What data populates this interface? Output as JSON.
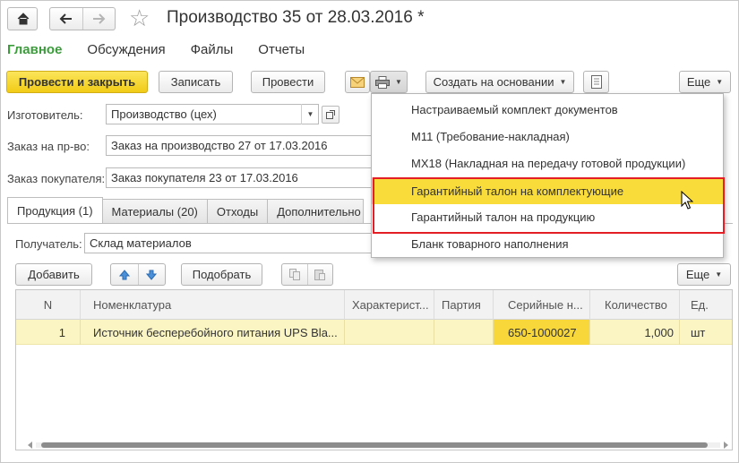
{
  "window": {
    "title": "Производство 35 от 28.03.2016 *"
  },
  "sections": [
    "Главное",
    "Обсуждения",
    "Файлы",
    "Отчеты"
  ],
  "toolbar": {
    "post_close": "Провести и закрыть",
    "save": "Записать",
    "post": "Провести",
    "create_based": "Создать на основании",
    "more": "Еще"
  },
  "fields": {
    "maker_label": "Изготовитель:",
    "maker_value": "Производство (цех)",
    "order_label": "Заказ на пр-во:",
    "order_value": "Заказ на производство 27 от 17.03.2016",
    "customer_label": "Заказ покупателя:",
    "customer_value": "Заказ покупателя 23 от 17.03.2016"
  },
  "tabs": [
    "Продукция (1)",
    "Материалы (20)",
    "Отходы",
    "Дополнительно"
  ],
  "recipient": {
    "label": "Получатель:",
    "value": "Склад материалов"
  },
  "table_toolbar": {
    "add": "Добавить",
    "pick": "Подобрать",
    "more": "Еще"
  },
  "table": {
    "columns": [
      "N",
      "Номенклатура",
      "Характерист...",
      "Партия",
      "Серийные н...",
      "Количество",
      "Ед."
    ],
    "rows": [
      [
        "1",
        "Источник бесперебойного питания UPS Bla...",
        "",
        "",
        "650-1000027",
        "1,000",
        "шт"
      ]
    ]
  },
  "print_menu": {
    "items": [
      "Настраиваемый комплект документов",
      "М11 (Требование-накладная)",
      "МХ18 (Накладная на передачу готовой продукции)",
      "Гарантийный талон на комплектующие",
      "Гарантийный талон на продукцию",
      "Бланк товарного наполнения"
    ],
    "highlighted_index": 3
  },
  "colors": {
    "primary_button": "#f5d22a",
    "active_section": "#3c9c3c",
    "row_highlight": "#fbf5c4",
    "menu_highlight": "#f9dc3a",
    "annotation_box": "#e31e24"
  }
}
